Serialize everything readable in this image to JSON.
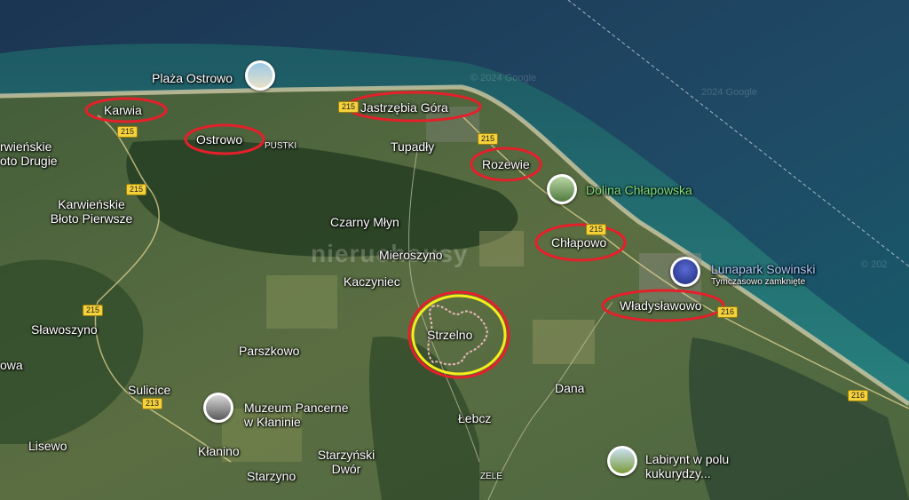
{
  "places": {
    "plaza_ostrowo": "Plaża Ostrowo",
    "karwia": "Karwia",
    "ostrowo": "Ostrowo",
    "pustki": "PUSTKI",
    "jastrzebia_gora": "Jastrzębia Góra",
    "tupadly": "Tupadły",
    "rozewie": "Rozewie",
    "dolina_chlapowska": "Dolina Chłapowska",
    "karwienskie_drugie": "rwieńskie\noto Drugie",
    "karwienskie_pierwsze": "Karwieńskie\nBłoto Pierwsze",
    "czarny_mlyn": "Czarny Młyn",
    "chlapowo": "Chłapowo",
    "mieroszyno": "Mieroszyno",
    "lunapark": "Lunapark Sowinski",
    "lunapark_status": "Tymczasowo zamknięte",
    "kaczyniec": "Kaczyniec",
    "wladyslawowo": "Władysławowo",
    "slawoszyno": "Sławoszyno",
    "strzelno": "Strzelno",
    "owa": "owa",
    "parszkowo": "Parszkowo",
    "sulicice": "Sulicice",
    "dana": "Dana",
    "muzeum": "Muzeum Pancerne\nw Kłaninie",
    "lebcz": "Łebcz",
    "lisewo": "Lisewo",
    "klanino": "Kłanino",
    "starzynski_dwor": "Starzyński\nDwór",
    "labirynt": "Labirynt w polu\nkukurydzy...",
    "starzyno": "Starzyno",
    "zele": "ZELE"
  },
  "roads": {
    "r215a": "215",
    "r215b": "215",
    "r215c": "215",
    "r215d": "215",
    "r215e": "215",
    "r215f": "215",
    "r216a": "216",
    "r216b": "216",
    "r213": "213"
  },
  "watermarks": {
    "google1": "© 2024 Google",
    "google2": "2024 Google",
    "google3": "© 202",
    "brand": "nieruchousy"
  },
  "colors": {
    "sea_deep": "#1f3d5a",
    "sea_shallow": "#1d6f72",
    "highlight_red": "#e4202a",
    "highlight_yellow": "#f4ee1a",
    "plot_outline": "#e8b8b8"
  }
}
